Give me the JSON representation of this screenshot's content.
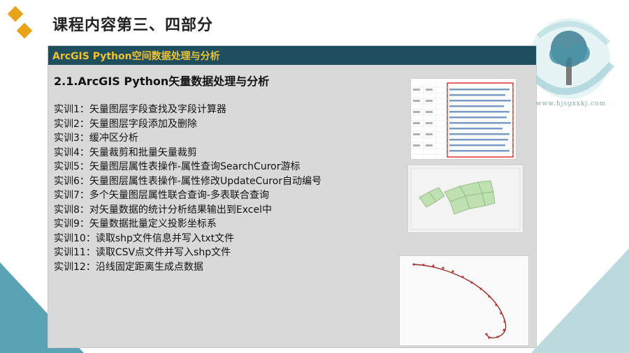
{
  "slide": {
    "title": "课程内容第三、四部分",
    "section_label": "ArcGIS Python空间数据处理与分析",
    "subheading": "2.1.ArcGIS Python矢量数据处理与分析",
    "items": [
      "实训1：矢量图层字段查找及字段计算器",
      "实训2：矢量图层字段添加及删除",
      "实训3：缓冲区分析",
      "实训4：矢量裁剪和批量矢量裁剪",
      "实训5：矢量图层属性表操作-属性查询SearchCuror游标",
      "实训6：矢量图层属性表操作-属性修改UpdateCuror自动编号",
      "实训7：多个矢量图层属性联合查询-多表联合查询",
      "实训8：对矢量数据的统计分析结果输出到Excel中",
      "实训9：矢量数据批量定义投影坐标系",
      "实训10：读取shp文件信息并写入txt文件",
      "实训11：读取CSV点文件并写入shp文件",
      "实训12：沿线固定距离生成点数据"
    ],
    "logo_url": "www.hjsgxxkj.com"
  },
  "colors": {
    "section_bar": "#1f4f5e",
    "section_text": "#f2c230",
    "accent_diamond": "#e8a317"
  }
}
